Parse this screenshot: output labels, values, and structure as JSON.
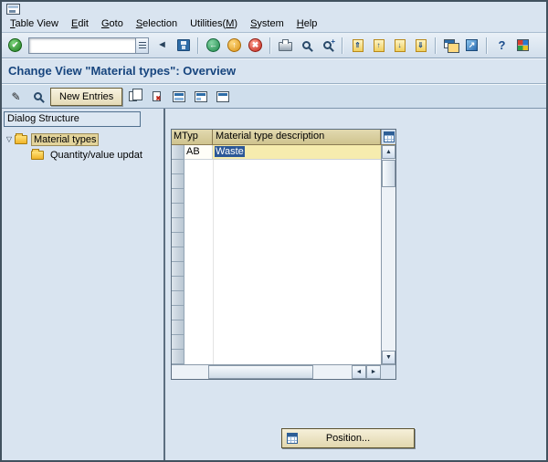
{
  "palette": {
    "window_bg": "#d9e4f0",
    "title_color": "#17457e",
    "table_header_bg": "#d6cc9e",
    "selection_bg": "#2b5797",
    "tree_selected_bg": "#e3d49b"
  },
  "menu": {
    "items": [
      {
        "pre": "",
        "accel": "T",
        "rest": "able View"
      },
      {
        "pre": "",
        "accel": "E",
        "rest": "dit"
      },
      {
        "pre": "",
        "accel": "G",
        "rest": "oto"
      },
      {
        "pre": "",
        "accel": "S",
        "rest": "election"
      },
      {
        "pre": "Utilities(",
        "accel": "M",
        "rest": ")"
      },
      {
        "pre": "",
        "accel": "S",
        "rest": "ystem"
      },
      {
        "pre": "",
        "accel": "H",
        "rest": "elp"
      }
    ]
  },
  "toolbar": {
    "command_value": ""
  },
  "icons": {
    "enter": "✔",
    "collapse": "◄",
    "back": "←",
    "exit": "↑",
    "cancel": "✖",
    "plus": "+",
    "first_page": "⇑",
    "prev_page": "↑",
    "next_page": "↓",
    "last_page": "⇓",
    "shortcut": "↗",
    "help": "?",
    "pencil": "✎",
    "scroll_up": "▲",
    "scroll_down": "▼",
    "scroll_left": "◄",
    "scroll_right": "►",
    "tree_expander": "▽"
  },
  "title": {
    "text": "Change View \"Material types\": Overview"
  },
  "app_toolbar": {
    "new_entries_label": "New Entries"
  },
  "sidebar": {
    "header": "Dialog Structure",
    "items": [
      {
        "label": "Material types",
        "selected": true
      },
      {
        "label": "Quantity/value updat",
        "selected": false
      }
    ]
  },
  "table": {
    "columns": [
      {
        "label": "MTyp"
      },
      {
        "label": "Material type description"
      }
    ],
    "rows": [
      {
        "mtyp": "AB",
        "desc": "Waste",
        "desc_selected": true
      }
    ],
    "empty_rows": 14
  },
  "footer": {
    "position_label": "Position..."
  }
}
